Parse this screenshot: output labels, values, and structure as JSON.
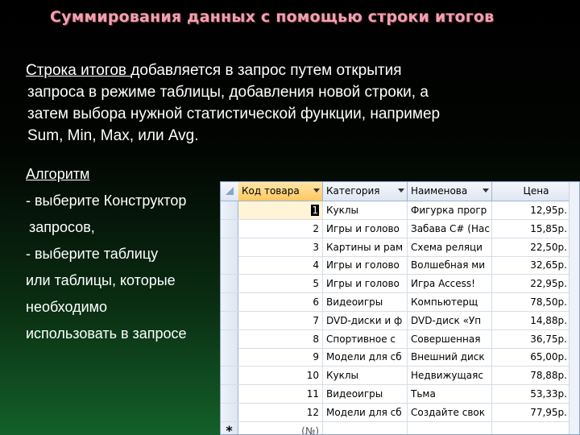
{
  "slide": {
    "title": "Суммирования данных с помощью строки итогов",
    "para_link": "Строка итогов ",
    "para_line1_rest": "добавляется в запрос путем открытия",
    "para_line2": "запроса в режиме таблицы, добавления новой строки, а",
    "para_line3": "затем выбора нужной статистической функции, например",
    "para_line4": "Sum, Min, Max, или Avg.",
    "algo_heading": "Алгоритм",
    "algo_lines": [
      "- выберите Конструктор",
      " запросов,",
      "- выберите таблицу",
      "или таблицы, которые",
      "необходимо",
      "использовать в запросе"
    ]
  },
  "table": {
    "columns": [
      "Код товара",
      "Категория",
      "Наименова",
      "Цена"
    ],
    "rows": [
      {
        "id": "1",
        "category": "Куклы",
        "name": "Фигурка прогр",
        "price": "12,95р."
      },
      {
        "id": "2",
        "category": "Игры и голово",
        "name": "Забава C# (Нас",
        "price": "15,85р."
      },
      {
        "id": "3",
        "category": "Картины и рам",
        "name": "Схема реляци",
        "price": "22,50р."
      },
      {
        "id": "4",
        "category": "Игры и голово",
        "name": "Волшебная ми",
        "price": "32,65р."
      },
      {
        "id": "5",
        "category": "Игры и голово",
        "name": "Игра Access!",
        "price": "22,95р."
      },
      {
        "id": "6",
        "category": "Видеоигры",
        "name": "Компьютерщ",
        "price": "78,50р."
      },
      {
        "id": "7",
        "category": "DVD-диски и ф",
        "name": "DVD-диск «Уп",
        "price": "14,88р."
      },
      {
        "id": "8",
        "category": "Спортивное с",
        "name": "Совершенная",
        "price": "36,75р."
      },
      {
        "id": "9",
        "category": "Модели для сб",
        "name": "Внешний диск",
        "price": "65,00р."
      },
      {
        "id": "10",
        "category": "Куклы",
        "name": "Недвижущаяс",
        "price": "78,88р."
      },
      {
        "id": "11",
        "category": "Видеоигры",
        "name": "Тьма",
        "price": "53,33р."
      },
      {
        "id": "12",
        "category": "Модели для сб",
        "name": "Создайте свок",
        "price": "77,95р."
      }
    ],
    "new_row_marker": "*",
    "new_row_id": "(№)"
  }
}
